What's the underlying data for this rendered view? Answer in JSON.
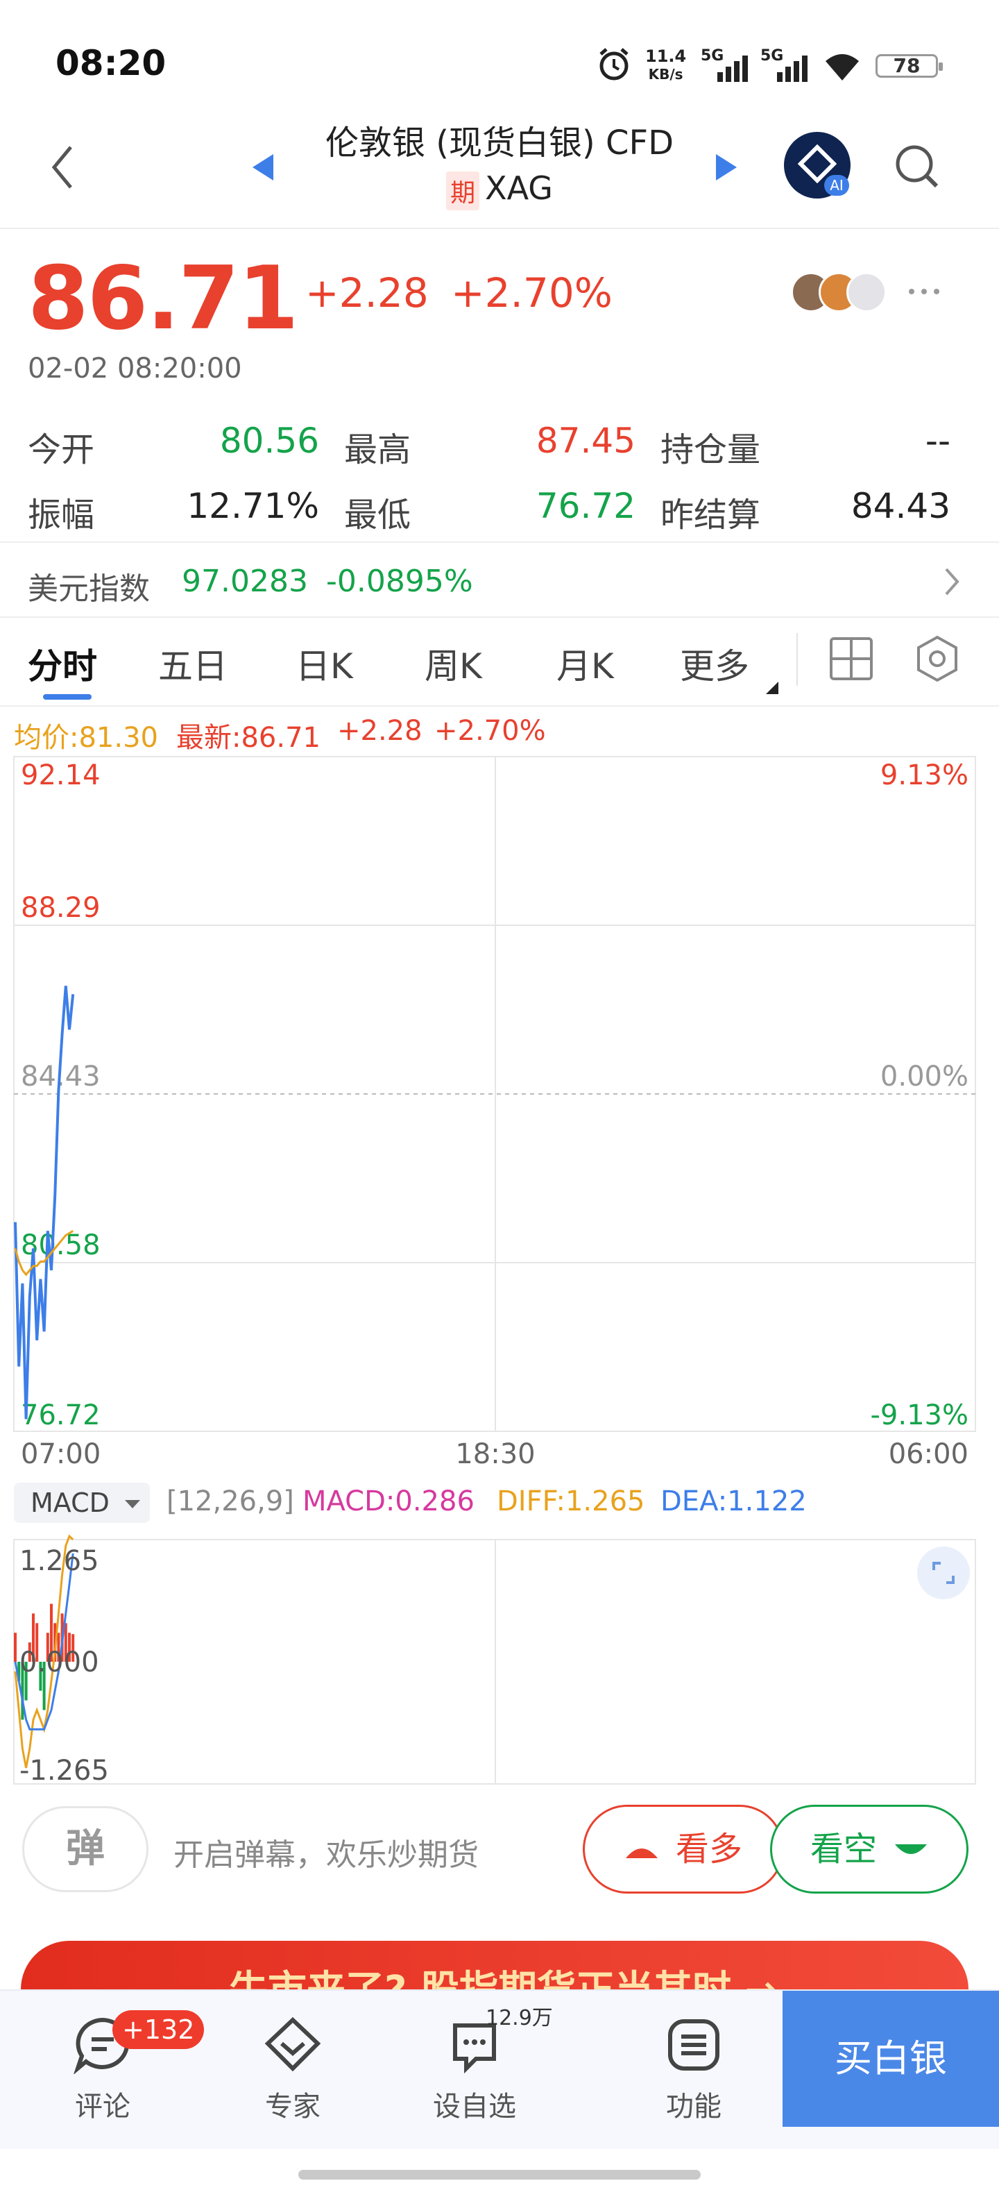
{
  "status_bar": {
    "time": "08:20",
    "net_speed_top": "11.4",
    "net_speed_unit": "KB/s",
    "signal_1": "5G",
    "signal_2": "5G",
    "battery": "78"
  },
  "header": {
    "title": "伦敦银 (现货白银) CFD",
    "tag": "期",
    "symbol": "XAG",
    "ai_label": "AI"
  },
  "quote": {
    "price": "86.71",
    "change": "+2.28",
    "change_pct": "+2.70%",
    "time": "02-02 08:20:00"
  },
  "stats": {
    "open_label": "今开",
    "open": "80.56",
    "high_label": "最高",
    "high": "87.45",
    "oi_label": "持仓量",
    "oi": "--",
    "amp_label": "振幅",
    "amp": "12.71%",
    "low_label": "最低",
    "low": "76.72",
    "settle_label": "昨结算",
    "settle": "84.43"
  },
  "usd_index": {
    "label": "美元指数",
    "value": "97.0283",
    "change": "-0.0895%"
  },
  "tabs": [
    "分时",
    "五日",
    "日K",
    "周K",
    "月K",
    "更多"
  ],
  "legend": {
    "avg": "均价:81.30",
    "latest": "最新:86.71",
    "change": "+2.28",
    "change_pct": "+2.70%"
  },
  "chart_data": [
    {
      "type": "line",
      "title": "",
      "y_labels_left": [
        "92.14",
        "88.29",
        "84.43",
        "80.58",
        "76.72"
      ],
      "y_labels_right": [
        "9.13%",
        "",
        "0.00%",
        "",
        "-9.13%"
      ],
      "x_labels": [
        "07:00",
        "18:30",
        "06:00"
      ],
      "ylim": [
        76.72,
        92.14
      ],
      "reference": 84.43,
      "series": [
        {
          "values": [
            81.5,
            78.2,
            80.1,
            77.0,
            79.8,
            80.9,
            78.8,
            80.2,
            79.0,
            81.3,
            80.4,
            82.1,
            84.5,
            85.8,
            86.9,
            85.9,
            86.71
          ]
        },
        {
          "values": [
            80.9,
            80.6,
            80.4,
            80.3,
            80.4,
            80.5,
            80.5,
            80.6,
            80.6,
            80.7,
            80.8,
            80.9,
            81.0,
            81.1,
            81.2,
            81.25,
            81.3
          ]
        }
      ]
    },
    {
      "type": "bar",
      "title": "",
      "indicator": "MACD",
      "params": "[12,26,9]",
      "macd": "MACD:0.286",
      "diff": "DIFF:1.265",
      "dea": "DEA:1.122",
      "y_labels": [
        "1.265",
        "0.000",
        "-1.265"
      ],
      "ylim": [
        -1.265,
        1.265
      ],
      "histogram": [
        0.3,
        -0.2,
        -0.6,
        -0.4,
        0.2,
        0.5,
        0.4,
        -0.3,
        -0.5,
        0.3,
        0.6,
        0.4,
        0.3,
        0.5,
        0.4,
        0.3,
        0.286
      ],
      "diff_values": [
        -0.1,
        -0.5,
        -0.9,
        -1.1,
        -0.9,
        -0.6,
        -0.5,
        -0.6,
        -0.7,
        -0.5,
        -0.2,
        0.1,
        0.5,
        0.9,
        1.2,
        1.3,
        1.265
      ],
      "dea_values": [
        0.0,
        -0.2,
        -0.4,
        -0.6,
        -0.7,
        -0.7,
        -0.7,
        -0.7,
        -0.7,
        -0.6,
        -0.5,
        -0.3,
        -0.1,
        0.2,
        0.5,
        0.8,
        1.122
      ]
    }
  ],
  "actions": {
    "danmu_icon": "弹",
    "danmu_text": "开启弹幕，欢乐炒期货",
    "bull": "看多",
    "bear": "看空"
  },
  "promo": {
    "text": "牛市来了? 股指期货正当其时 →"
  },
  "bottom_nav": {
    "comments": "评论",
    "badge": "+132",
    "experts": "专家",
    "fav": "设自选",
    "fav_count": "12.9万",
    "functions": "功能",
    "buy": "买白银"
  }
}
